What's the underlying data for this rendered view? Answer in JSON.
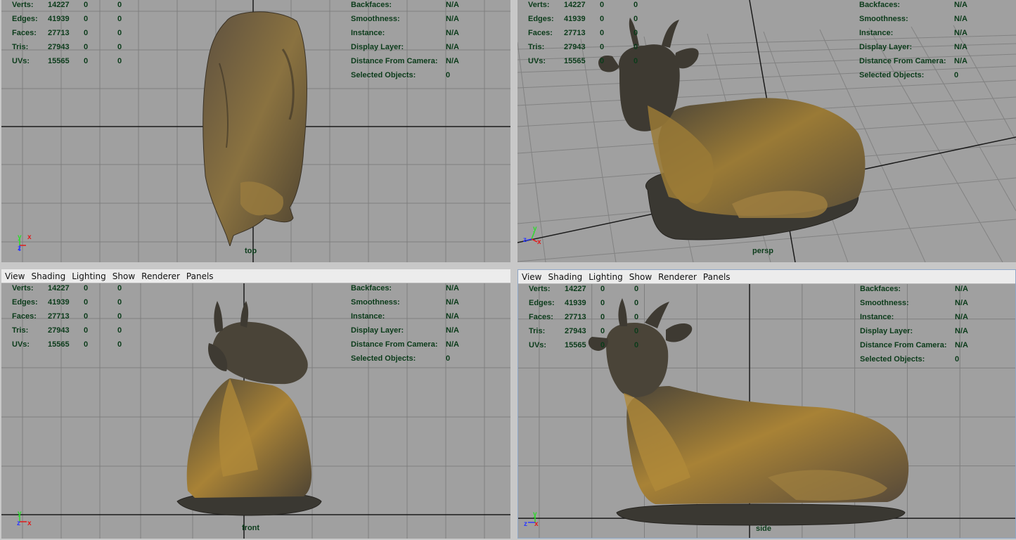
{
  "menu": [
    "View",
    "Shading",
    "Lighting",
    "Show",
    "Renderer",
    "Panels"
  ],
  "stats": {
    "rows": [
      {
        "label": "Verts:",
        "values": [
          "14227",
          "0",
          "0"
        ]
      },
      {
        "label": "Edges:",
        "values": [
          "41939",
          "0",
          "0"
        ]
      },
      {
        "label": "Faces:",
        "values": [
          "27713",
          "0",
          "0"
        ]
      },
      {
        "label": "Tris:",
        "values": [
          "27943",
          "0",
          "0"
        ]
      },
      {
        "label": "UVs:",
        "values": [
          "15565",
          "0",
          "0"
        ]
      }
    ]
  },
  "info": {
    "rows": [
      {
        "label": "Backfaces:",
        "value": "N/A"
      },
      {
        "label": "Smoothness:",
        "value": "N/A"
      },
      {
        "label": "Instance:",
        "value": "N/A"
      },
      {
        "label": "Display Layer:",
        "value": "N/A"
      },
      {
        "label": "Distance From Camera:",
        "value": "N/A"
      },
      {
        "label": "Selected Objects:",
        "value": "0"
      }
    ]
  },
  "viewports": {
    "top": {
      "camera": "top"
    },
    "persp": {
      "camera": "persp"
    },
    "front": {
      "camera": "front"
    },
    "side": {
      "camera": "side"
    }
  },
  "axis_labels": {
    "x": "x",
    "y": "y",
    "z": "z"
  },
  "colors": {
    "viewport_bg": "#a0a0a0",
    "grid": "#7e7e7e",
    "hud_text": "#0b3b1a",
    "axis_x": "#e01b1b",
    "axis_y": "#2bdc2b",
    "axis_z": "#2d3bff"
  }
}
